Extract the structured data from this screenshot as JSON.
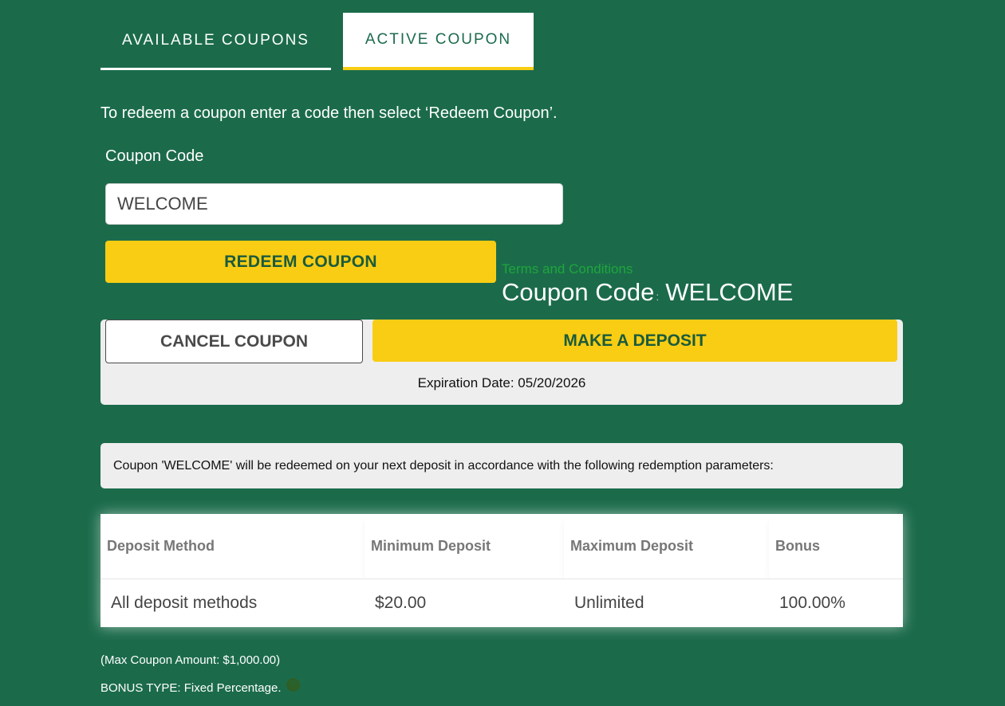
{
  "tabs": {
    "available": "AVAILABLE COUPONS",
    "active": "ACTIVE COUPON"
  },
  "instructions": "To redeem a coupon enter a code then select ‘Redeem Coupon’.",
  "form": {
    "code_label": "Coupon Code",
    "code_value": "WELCOME",
    "redeem_label": "REDEEM COUPON"
  },
  "active_coupon": {
    "terms_link": "Terms and Conditions",
    "code_label": "Coupon Code",
    "separator": ":",
    "code_value": "WELCOME"
  },
  "actions": {
    "cancel_label": "CANCEL COUPON",
    "deposit_label": "MAKE A DEPOSIT",
    "expiration": "Expiration Date: 05/20/2026"
  },
  "notice": "Coupon 'WELCOME' will be redeemed on your next deposit in accordance with the following redemption parameters:",
  "parameters": {
    "headers": [
      "Deposit Method",
      "Minimum Deposit",
      "Maximum Deposit",
      "Bonus"
    ],
    "rows": [
      [
        "All deposit methods",
        "$20.00",
        "Unlimited",
        "100.00%"
      ]
    ]
  },
  "footer": {
    "max_amount": "(Max Coupon Amount: $1,000.00)",
    "bonus_type": "BONUS TYPE: Fixed Percentage.",
    "info_icon_glyph": "?"
  },
  "colors": {
    "background": "#1b6b4b",
    "accent_yellow": "#f8cd14",
    "button_text": "#1b5b3c",
    "link_green": "#1ea63a"
  }
}
